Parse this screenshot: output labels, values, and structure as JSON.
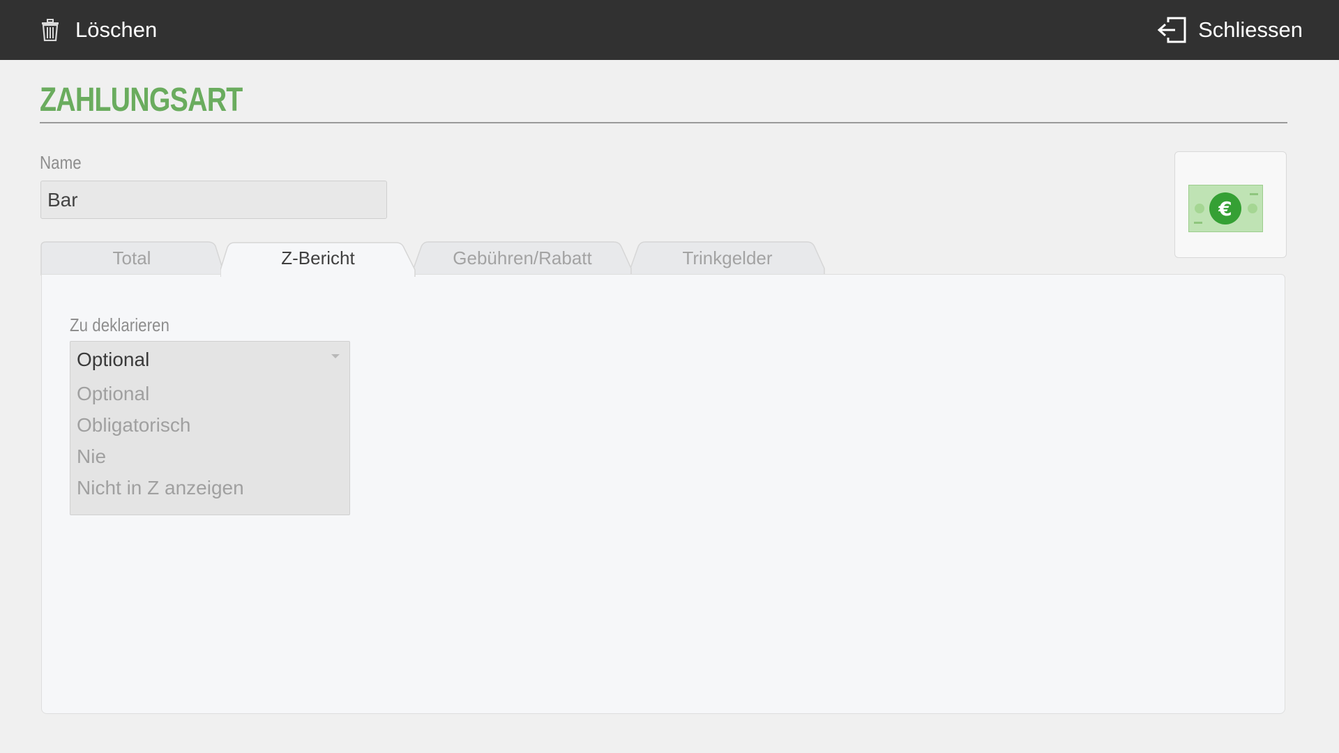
{
  "toolbar": {
    "delete_label": "Löschen",
    "delete_icon": "trash-icon",
    "close_label": "Schliessen",
    "close_icon": "exit-icon"
  },
  "page": {
    "title": "Zahlungsart"
  },
  "form": {
    "name_label": "Name",
    "name_value": "Bar",
    "image_icon": "euro-banknote-icon"
  },
  "tabs": [
    {
      "label": "Total",
      "active": false
    },
    {
      "label": "Z-Bericht",
      "active": true
    },
    {
      "label": "Gebühren/Rabatt",
      "active": false
    },
    {
      "label": "Trinkgelder",
      "active": false
    }
  ],
  "zbericht": {
    "declare_label": "Zu deklarieren",
    "selected": "Optional",
    "options": [
      "Optional",
      "Obligatorisch",
      "Nie",
      "Nicht in Z anzeigen"
    ]
  },
  "colors": {
    "topbar": "#313131",
    "accent_green": "#6aac5e",
    "background": "#f0f0f0"
  }
}
